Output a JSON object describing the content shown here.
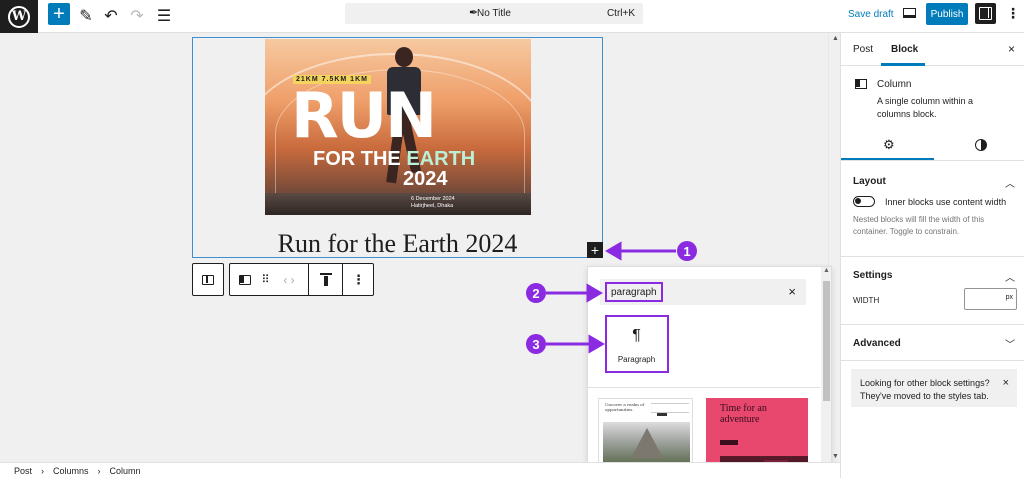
{
  "topbar": {
    "wp_logo": "W",
    "add_label": "+",
    "doc_title": "No Title",
    "shortcut": "Ctrl+K",
    "save_draft": "Save draft",
    "publish": "Publish"
  },
  "canvas": {
    "poster": {
      "distances": "21KM  7.5KM  1KM",
      "big_word": "RUN",
      "line2_prefix": "FOR THE ",
      "line2_accent": "EARTH",
      "year": "2024",
      "date": "6 December 2024",
      "venue": "Hatirjheel, Dhaka"
    },
    "heading": "Run for the Earth 2024",
    "inserter_plus": "+"
  },
  "inserter": {
    "search_value": "paragraph",
    "clear": "×",
    "result_icon": "¶",
    "result_label": "Paragraph",
    "pattern1_text": "Uncover a realm of opportunities.",
    "pattern2_title": "Time for an adventure"
  },
  "annotations": {
    "step1": "1",
    "step2": "2",
    "step3": "3",
    "color": "#8a2be2"
  },
  "sidebar": {
    "tab_post": "Post",
    "tab_block": "Block",
    "close": "×",
    "block_title": "Column",
    "block_desc": "A single column within a columns block.",
    "layout_title": "Layout",
    "toggle_label": "Inner blocks use content width",
    "layout_help": "Nested blocks will fill the width of this container. Toggle to constrain.",
    "settings_title": "Settings",
    "width_label": "WIDTH",
    "width_unit": "px",
    "advanced_title": "Advanced",
    "notice": "Looking for other block settings? They've moved to the styles tab.",
    "notice_close": "×"
  },
  "footer": {
    "crumbs": [
      "Post",
      "Columns",
      "Column"
    ]
  },
  "icons": {
    "accent": "#007cba",
    "selection_border": "#3e8fd0"
  }
}
